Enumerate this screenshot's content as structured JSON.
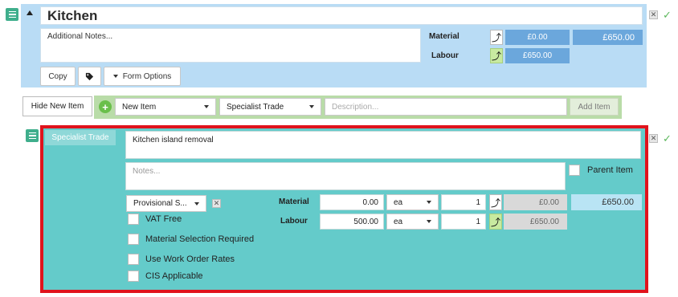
{
  "section": {
    "title": "Kitchen",
    "notes_placeholder": "Additional Notes...",
    "material_label": "Material",
    "labour_label": "Labour",
    "material_value": "£0.00",
    "labour_value": "£650.00",
    "total": "£650.00",
    "copy_label": "Copy",
    "form_options_label": "Form Options"
  },
  "add_row": {
    "hide_label": "Hide New Item",
    "item_select": "New Item",
    "trade_select": "Specialist Trade",
    "description_placeholder": "Description...",
    "add_label": "Add Item"
  },
  "item": {
    "trade_tag": "Specialist Trade",
    "description": "Kitchen island removal",
    "notes_placeholder": "Notes...",
    "parent_label": "Parent Item",
    "sum_select": "Provisional S...",
    "material_label": "Material",
    "labour_label": "Labour",
    "material_price": "0.00",
    "labour_price": "500.00",
    "material_unit": "ea",
    "labour_unit": "ea",
    "material_qty": "1",
    "labour_qty": "1",
    "material_total": "£0.00",
    "labour_total": "£650.00",
    "grand_total": "£650.00",
    "checkboxes": [
      "VAT Free",
      "Material Selection Required",
      "Use Work Order Rates",
      "CIS Applicable"
    ]
  },
  "colors": {
    "section_bg": "#b9dcf5",
    "add_row_bg": "#b9dca8",
    "item_bg": "#64cbca",
    "highlight_border": "#e0131c",
    "handle_green": "#3fae8c"
  },
  "icons": {
    "collapse": "triangle-up-icon",
    "tag": "tag-icon",
    "plus": "plus-circle-icon",
    "delete": "close-icon",
    "confirm": "check-icon",
    "move": "menu-icon"
  }
}
